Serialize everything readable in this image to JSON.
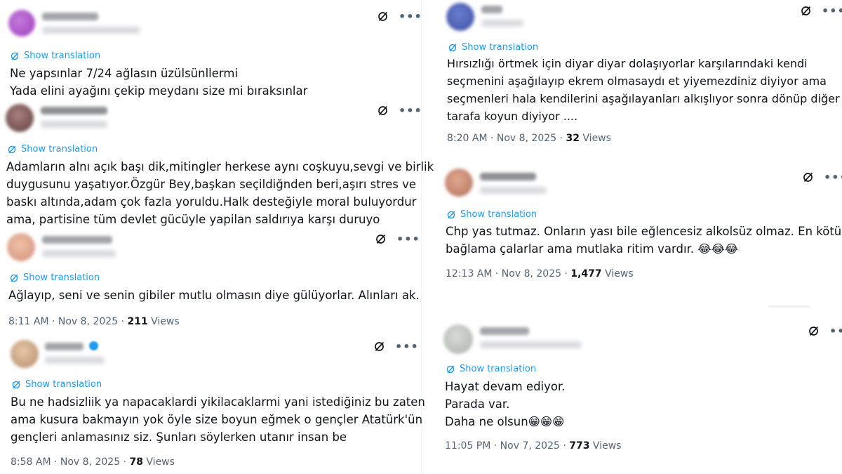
{
  "show_translation": "Show translation",
  "icons": {
    "grok": "grok-icon",
    "more": "more-options-icon",
    "translate": "translate-icon"
  },
  "colors": {
    "link": "#1d9bf0",
    "secondary": "#536471",
    "text": "#0f1419"
  },
  "left_column": [
    {
      "lines": [
        "Ne yapsınlar 7/24 ağlasın üzülsünllermi",
        "Yada elini ayağını çekip meydanı size mi bıraksınlar"
      ],
      "time": "",
      "views_count": "",
      "views_label": ""
    },
    {
      "lines": [
        "Adamların alnı açık başı dik,mitingler herkese aynı coşkuyu,sevgi ve birlik",
        "duygusunu yaşatıyor.Özgür Bey,başkan seçildiğnden beri,aşırı stres ve",
        "baskı altında,adam çok fazla yoruldu.Halk desteğiyle moral buluyordur",
        "ama, partisine tüm devlet gücüyle yapilan saldırıya karşı duruyo"
      ],
      "time": "",
      "views_count": "",
      "views_label": ""
    },
    {
      "lines": [
        "Ağlayıp, seni ve senin gibiler mutlu olmasın diye gülüyorlar. Alınları ak."
      ],
      "time": "8:11 AM · Nov 8, 2025 · ",
      "views_count": "211",
      "views_label": " Views"
    },
    {
      "lines": [
        "Bu ne hadsizliik ya napacaklardi yikilacaklarmi yani istediğiniz bu zaten",
        "ama kusura bakmayın yok öyle size boyun eğmek o gençler Atatürk'ün",
        "gençleri anlamasınız siz. Şunları söylerken utanır insan be"
      ],
      "time": "8:58 AM · Nov 8, 2025 · ",
      "views_count": "78",
      "views_label": " Views"
    }
  ],
  "right_column": [
    {
      "lines": [
        "Hırsızlığı örtmek için diyar diyar dolaşıyorlar karşılarındaki kendi",
        "seçmenini aşağılayıp ekrem olmasaydı et yiyemezdiniz diyiyor ama",
        "seçmenleri hala kendilerini aşağılayanları alkışlıyor  sonra dönüp diğer",
        "tarafa koyun diyiyor ...."
      ],
      "time": "8:20 AM · Nov 8, 2025 · ",
      "views_count": "32",
      "views_label": " Views"
    },
    {
      "lines": [
        "Chp yas tutmaz. Onların yası bile eğlencesiz alkolsüz olmaz. En kötü saz",
        "bağlama çalarlar ama mutlaka ritim vardır. 😂😂😂"
      ],
      "time": "12:13 AM · Nov 8, 2025 · ",
      "views_count": "1,477",
      "views_label": " Views"
    },
    {
      "lines": [
        "Hayat devam ediyor.",
        "Parada var.",
        "Daha ne olsun😁😁😁"
      ],
      "time": "11:05 PM · Nov 7, 2025 · ",
      "views_count": "773",
      "views_label": " Views"
    }
  ]
}
